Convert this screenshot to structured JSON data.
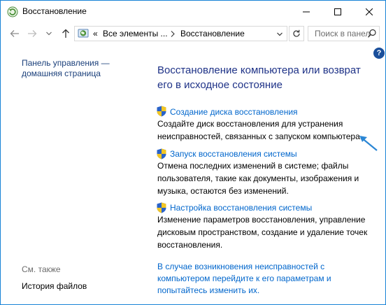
{
  "window": {
    "title": "Восстановление",
    "icon": "recovery-icon"
  },
  "navigation": {
    "breadcrumb_prefix": "«",
    "breadcrumb_1": "Все элементы ...",
    "breadcrumb_2": "Восстановление",
    "search_placeholder": "Поиск в панели управления"
  },
  "left_pane": {
    "home_link_line1": "Панель управления —",
    "home_link_line2": "домашняя страница",
    "see_also": "См. также",
    "file_history": "История файлов"
  },
  "main": {
    "title_line1": "Восстановление компьютера или возврат",
    "title_line2": "его в исходное состояние",
    "items": [
      {
        "link": "Создание диска восстановления",
        "desc_line1": "Создайте диск восстановления для устранения",
        "desc_line2": "неисправностей, связанных с запуском компьютера."
      },
      {
        "link": "Запуск восстановления системы",
        "desc_line1": "Отмена последних изменений в системе; файлы",
        "desc_line2": "пользователя, такие как документы, изображения и",
        "desc_line3": "музыка, остаются без изменений."
      },
      {
        "link": "Настройка восстановления системы",
        "desc_line1": "Изменение параметров восстановления, управление",
        "desc_line2": "дисковым пространством, создание и удаление точек",
        "desc_line3": "восстановления."
      }
    ],
    "bottom_line1": "В случае возникновения неисправностей с",
    "bottom_line2": "компьютером перейдите к его параметрам и",
    "bottom_line3": "попытайтесь изменить их."
  },
  "colors": {
    "accent": "#1883d7",
    "link": "#0066cc",
    "heading": "#1e3287",
    "shield_blue": "#2a63c9",
    "shield_yellow": "#f3c623"
  }
}
